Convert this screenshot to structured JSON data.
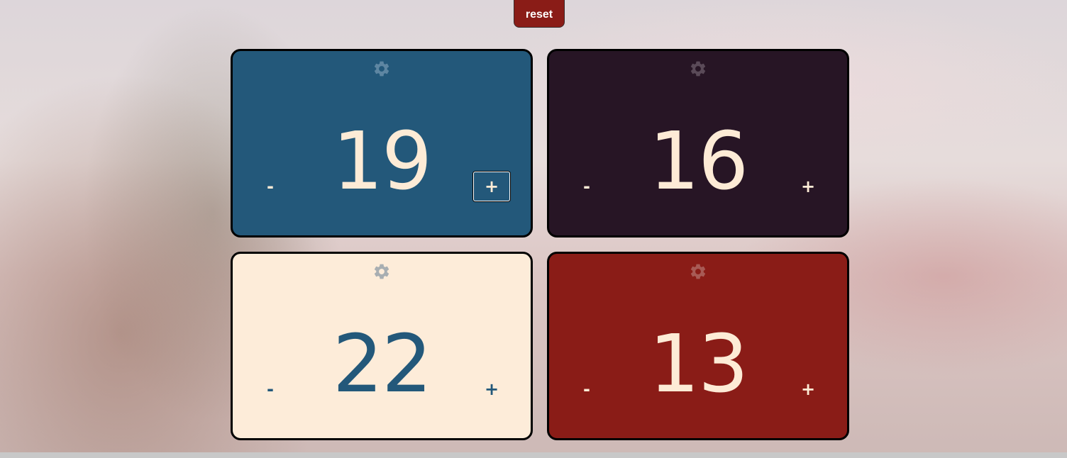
{
  "reset_label": "reset",
  "players": [
    {
      "life": "19",
      "minus_label": "-",
      "plus_label": "+",
      "bg": "#23587a",
      "fg": "#fdebd6",
      "gear": "#5e86a2"
    },
    {
      "life": "16",
      "minus_label": "-",
      "plus_label": "+",
      "bg": "#271525",
      "fg": "#fdebd6",
      "gear": "#5a4a58"
    },
    {
      "life": "22",
      "minus_label": "-",
      "plus_label": "+",
      "bg": "#fdecd9",
      "fg": "#23587a",
      "gear": "#a8aeb2"
    },
    {
      "life": "13",
      "minus_label": "-",
      "plus_label": "+",
      "bg": "#8a1c17",
      "fg": "#fdebd6",
      "gear": "#a85a55"
    }
  ]
}
